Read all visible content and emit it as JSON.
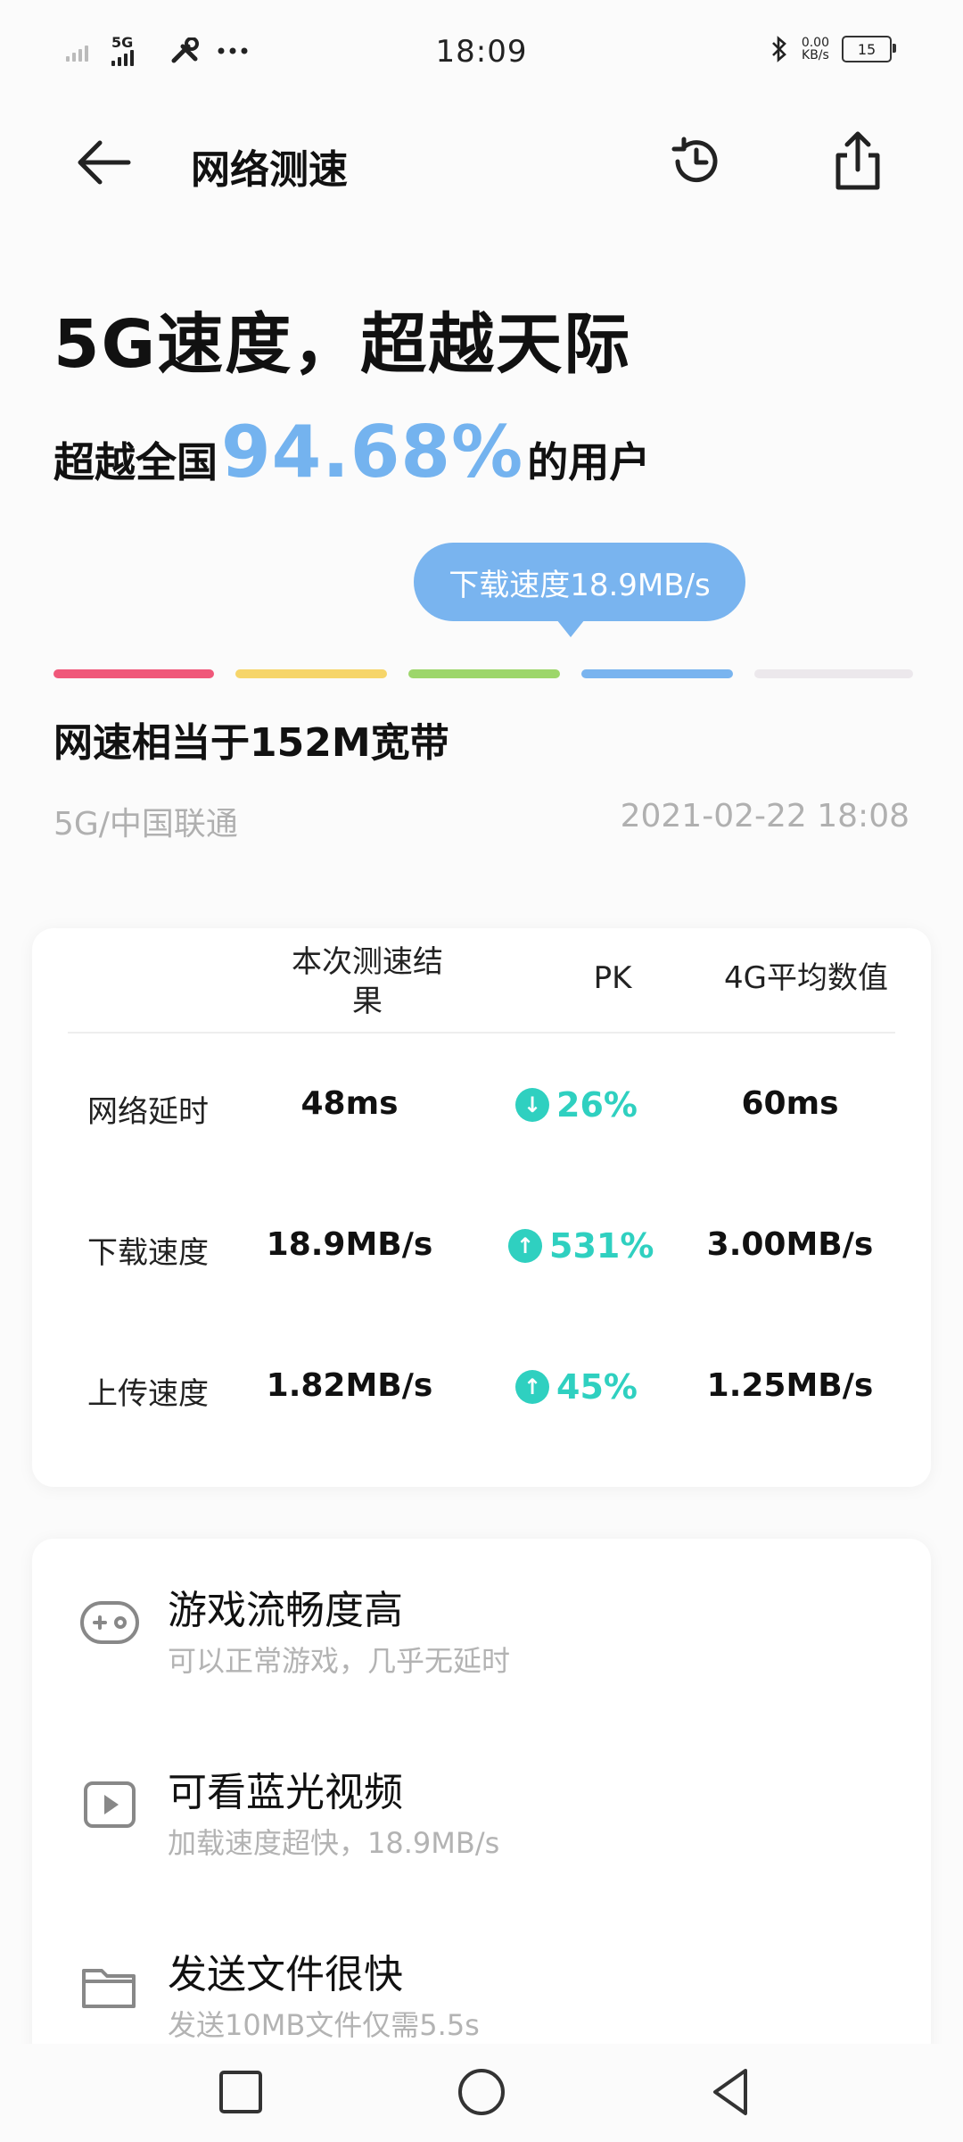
{
  "status_bar": {
    "time": "18:09",
    "network_type": "5G",
    "net_speed_value": "0.00",
    "net_speed_unit": "KB/s",
    "battery": "15"
  },
  "app_bar": {
    "title": "网络测速"
  },
  "result": {
    "headline": "5G速度，超越天际",
    "percentile_prefix": "超越全国",
    "percentile_value": "94.68%",
    "percentile_suffix": "的用户",
    "bubble": "下载速度18.9MB/s",
    "level_colors": [
      "#f0587a",
      "#f6d56a",
      "#9dd66b",
      "#79b4ef",
      "#ece8ec"
    ],
    "equivalent": "网速相当于152M宽带",
    "carrier": "5G/中国联通",
    "timestamp": "2021-02-22 18:08"
  },
  "table": {
    "headers": {
      "current": "本次测速结果",
      "pk": "PK",
      "average": "4G平均数值"
    },
    "rows": [
      {
        "label": "网络延时",
        "current": "48ms",
        "pk": "26%",
        "pk_dir": "down",
        "average": "60ms"
      },
      {
        "label": "下载速度",
        "current": "18.9MB/s",
        "pk": "531%",
        "pk_dir": "up",
        "average": "3.00MB/s"
      },
      {
        "label": "上传速度",
        "current": "1.82MB/s",
        "pk": "45%",
        "pk_dir": "up",
        "average": "1.25MB/s"
      }
    ]
  },
  "features": [
    {
      "title": "游戏流畅度高",
      "subtitle": "可以正常游戏，几乎无延时",
      "icon": "gamepad-icon"
    },
    {
      "title": "可看蓝光视频",
      "subtitle": "加载速度超快，18.9MB/s",
      "icon": "video-play-icon"
    },
    {
      "title": "发送文件很快",
      "subtitle": "发送10MB文件仅需5.5s",
      "icon": "folder-icon"
    }
  ],
  "colors": {
    "accent": "#79b4ef",
    "pk_positive": "#2fd0c0",
    "muted_text": "#b0b0b0"
  }
}
